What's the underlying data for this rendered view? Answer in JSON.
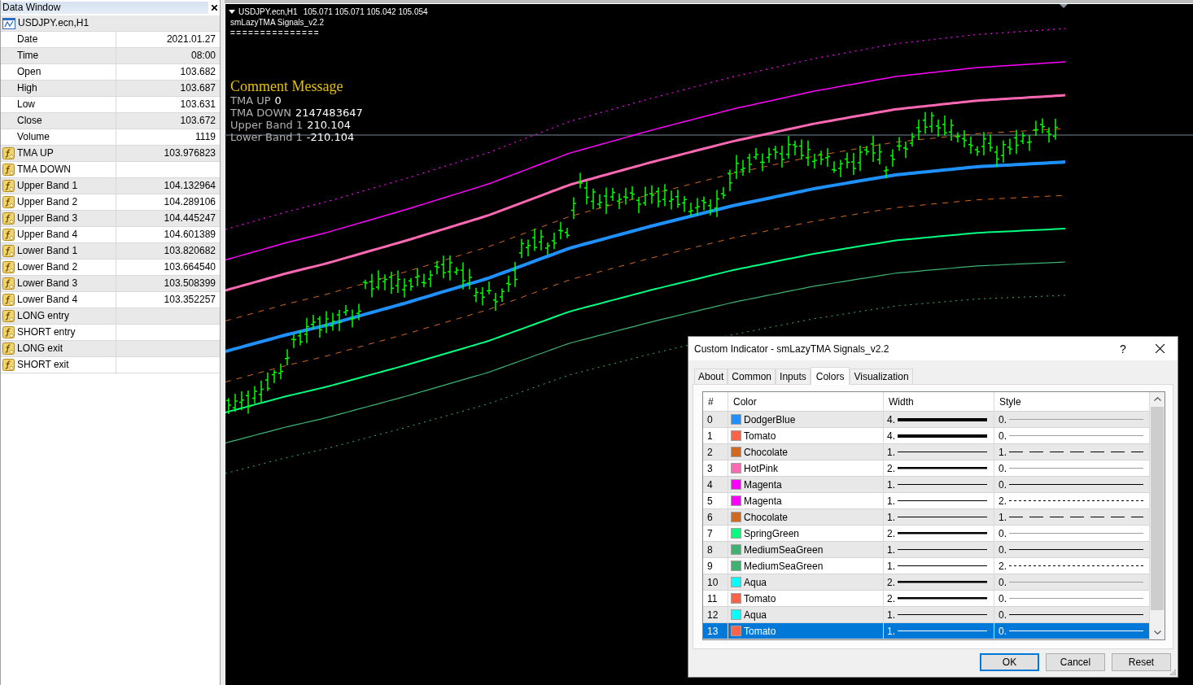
{
  "data_window": {
    "title": "Data Window",
    "symbol": "USDJPY.ecn,H1",
    "rows": [
      {
        "kind": "field",
        "name": "Date",
        "value": "2021.01.27"
      },
      {
        "kind": "field",
        "name": "Time",
        "value": "08:00"
      },
      {
        "kind": "field",
        "name": "Open",
        "value": "103.682"
      },
      {
        "kind": "field",
        "name": "High",
        "value": "103.687"
      },
      {
        "kind": "field",
        "name": "Low",
        "value": "103.631"
      },
      {
        "kind": "field",
        "name": "Close",
        "value": "103.672"
      },
      {
        "kind": "field",
        "name": "Volume",
        "value": "1119"
      },
      {
        "kind": "indicator",
        "name": "TMA UP",
        "value": "103.976823"
      },
      {
        "kind": "indicator",
        "name": "TMA DOWN"
      },
      {
        "kind": "indicator",
        "name": "Upper Band 1",
        "value": "104.132964"
      },
      {
        "kind": "indicator",
        "name": "Upper Band 2",
        "value": "104.289106"
      },
      {
        "kind": "indicator",
        "name": "Upper Band 3",
        "value": "104.445247"
      },
      {
        "kind": "indicator",
        "name": "Upper Band 4",
        "value": "104.601389"
      },
      {
        "kind": "indicator",
        "name": "Lower Band 1",
        "value": "103.820682"
      },
      {
        "kind": "indicator",
        "name": "Lower Band 2",
        "value": "103.664540"
      },
      {
        "kind": "indicator",
        "name": "Lower Band 3",
        "value": "103.508399"
      },
      {
        "kind": "indicator",
        "name": "Lower Band 4",
        "value": "103.352257"
      },
      {
        "kind": "indicator",
        "name": "LONG entry"
      },
      {
        "kind": "indicator",
        "name": "SHORT entry"
      },
      {
        "kind": "indicator",
        "name": "LONG exit"
      },
      {
        "kind": "indicator",
        "name": "SHORT exit"
      }
    ]
  },
  "chart": {
    "symbol": "USDJPY.ecn,H1",
    "quotes": "105.071 105.071 105.042 105.054",
    "indicator": "smLazyTMA Signals_v2.2",
    "separator": "===============",
    "comment": {
      "title": "Comment Message",
      "lines": [
        {
          "label": "TMA UP",
          "value": "0"
        },
        {
          "label": "TMA DOWN",
          "value": "2147483647"
        },
        {
          "label": "Upper Band 1",
          "value": "210.104"
        },
        {
          "label": "Lower Band 1",
          "value": "-210.104"
        }
      ]
    }
  },
  "dialog": {
    "title": "Custom Indicator - smLazyTMA Signals_v2.2",
    "help": "?",
    "tabs": [
      {
        "label": "About",
        "selected": false
      },
      {
        "label": "Common",
        "selected": false
      },
      {
        "label": "Inputs",
        "selected": false
      },
      {
        "label": "Colors",
        "selected": true
      },
      {
        "label": "Visualization",
        "selected": false
      }
    ],
    "table": {
      "columns": [
        "#",
        "Color",
        "Width",
        "Style"
      ],
      "rows": [
        {
          "index": "0",
          "color": "#1e90ff",
          "color_name": "DodgerBlue",
          "width": {
            "value": "4.",
            "kind": "heavy"
          },
          "style": {
            "value": "0.",
            "kind": "disabled"
          },
          "selected": false
        },
        {
          "index": "1",
          "color": "#ff6347",
          "color_name": "Tomato",
          "width": {
            "value": "4.",
            "kind": "heavy"
          },
          "style": {
            "value": "0.",
            "kind": "disabled"
          },
          "selected": false
        },
        {
          "index": "2",
          "color": "#d2691e",
          "color_name": "Chocolate",
          "width": {
            "value": "1.",
            "kind": "thin"
          },
          "style": {
            "value": "1.",
            "kind": "dash"
          },
          "selected": false
        },
        {
          "index": "3",
          "color": "#ff69b4",
          "color_name": "HotPink",
          "width": {
            "value": "2.",
            "kind": "medium"
          },
          "style": {
            "value": "0.",
            "kind": "disabled"
          },
          "selected": false
        },
        {
          "index": "4",
          "color": "#ff00ff",
          "color_name": "Magenta",
          "width": {
            "value": "1.",
            "kind": "thin"
          },
          "style": {
            "value": "0.",
            "kind": "solid"
          },
          "selected": false
        },
        {
          "index": "5",
          "color": "#ff00ff",
          "color_name": "Magenta",
          "width": {
            "value": "1.",
            "kind": "thin"
          },
          "style": {
            "value": "2.",
            "kind": "dot"
          },
          "selected": false
        },
        {
          "index": "6",
          "color": "#d2691e",
          "color_name": "Chocolate",
          "width": {
            "value": "1.",
            "kind": "thin"
          },
          "style": {
            "value": "1.",
            "kind": "dash"
          },
          "selected": false
        },
        {
          "index": "7",
          "color": "#00ff7f",
          "color_name": "SpringGreen",
          "width": {
            "value": "2.",
            "kind": "medium"
          },
          "style": {
            "value": "0.",
            "kind": "disabled"
          },
          "selected": false
        },
        {
          "index": "8",
          "color": "#3cb371",
          "color_name": "MediumSeaGreen",
          "width": {
            "value": "1.",
            "kind": "thin"
          },
          "style": {
            "value": "0.",
            "kind": "solid"
          },
          "selected": false
        },
        {
          "index": "9",
          "color": "#3cb371",
          "color_name": "MediumSeaGreen",
          "width": {
            "value": "1.",
            "kind": "thin"
          },
          "style": {
            "value": "2.",
            "kind": "dot"
          },
          "selected": false
        },
        {
          "index": "10",
          "color": "#00ffff",
          "color_name": "Aqua",
          "width": {
            "value": "2.",
            "kind": "medium"
          },
          "style": {
            "value": "0.",
            "kind": "disabled"
          },
          "selected": false
        },
        {
          "index": "11",
          "color": "#ff6347",
          "color_name": "Tomato",
          "width": {
            "value": "2.",
            "kind": "medium"
          },
          "style": {
            "value": "0.",
            "kind": "disabled"
          },
          "selected": false
        },
        {
          "index": "12",
          "color": "#00ffff",
          "color_name": "Aqua",
          "width": {
            "value": "1.",
            "kind": "thin"
          },
          "style": {
            "value": "0.",
            "kind": "solid"
          },
          "selected": false
        },
        {
          "index": "13",
          "color": "#ff6347",
          "color_name": "Tomato",
          "width": {
            "value": "1.",
            "kind": "thin"
          },
          "style": {
            "value": "0.",
            "kind": "solid"
          },
          "selected": true
        }
      ]
    },
    "buttons": [
      {
        "label": "OK",
        "default": true
      },
      {
        "label": "Cancel",
        "default": false
      },
      {
        "label": "Reset",
        "default": false
      }
    ]
  }
}
